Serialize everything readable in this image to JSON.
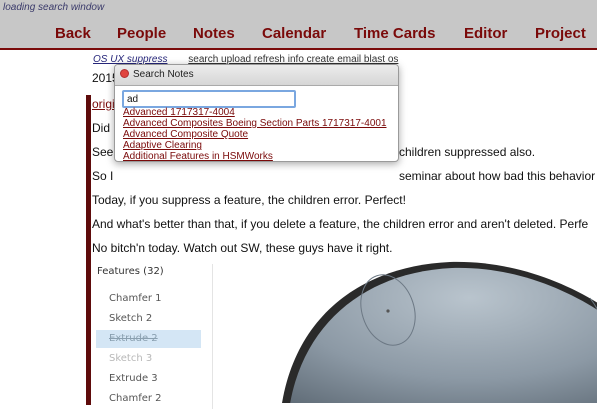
{
  "status_text": "loading search window",
  "nav": [
    "Back",
    "People",
    "Notes",
    "Calendar",
    "Time Cards",
    "Editor",
    "Project"
  ],
  "subnav": {
    "first": "OS UX suppress",
    "rest": "search upload refresh info create email blast os"
  },
  "content": {
    "year_fragment": "2015",
    "link_fragment": "origi",
    "did_fragment": "Did",
    "seen_fragment": "Seen",
    "seen_tail": "children suppressed also.",
    "so_fragment": "So I",
    "so_tail": "seminar about how bad this behavior w",
    "p1": "Today, if you suppress a feature, the children error. Perfect!",
    "p2": "And what's better than that, if you delete a feature, the children error and aren't deleted. Perfe",
    "p3": "No bitch'n today. Watch out SW, these guys have it right."
  },
  "features": {
    "header": "Features (32)",
    "items": [
      {
        "label": "Chamfer 1",
        "state": "normal"
      },
      {
        "label": "Sketch 2",
        "state": "normal"
      },
      {
        "label": "Extrude 2",
        "state": "suppressed-selected"
      },
      {
        "label": "Sketch 3",
        "state": "dim"
      },
      {
        "label": "Extrude 3",
        "state": "normal"
      },
      {
        "label": "Chamfer 2",
        "state": "normal"
      }
    ]
  },
  "dialog": {
    "title": "Search Notes",
    "search_value": "ad",
    "results": [
      "Advanced 1717317-4004",
      "Advanced Composites Boeing Section Parts 1717317-4001",
      "Advanced Composite Quote",
      "Adaptive Clearing",
      "Additional Features in HSMWorks"
    ]
  },
  "colors": {
    "accent": "#7a0a0a",
    "topbar": "#c7c7c7",
    "selection": "#d4e6f5"
  }
}
